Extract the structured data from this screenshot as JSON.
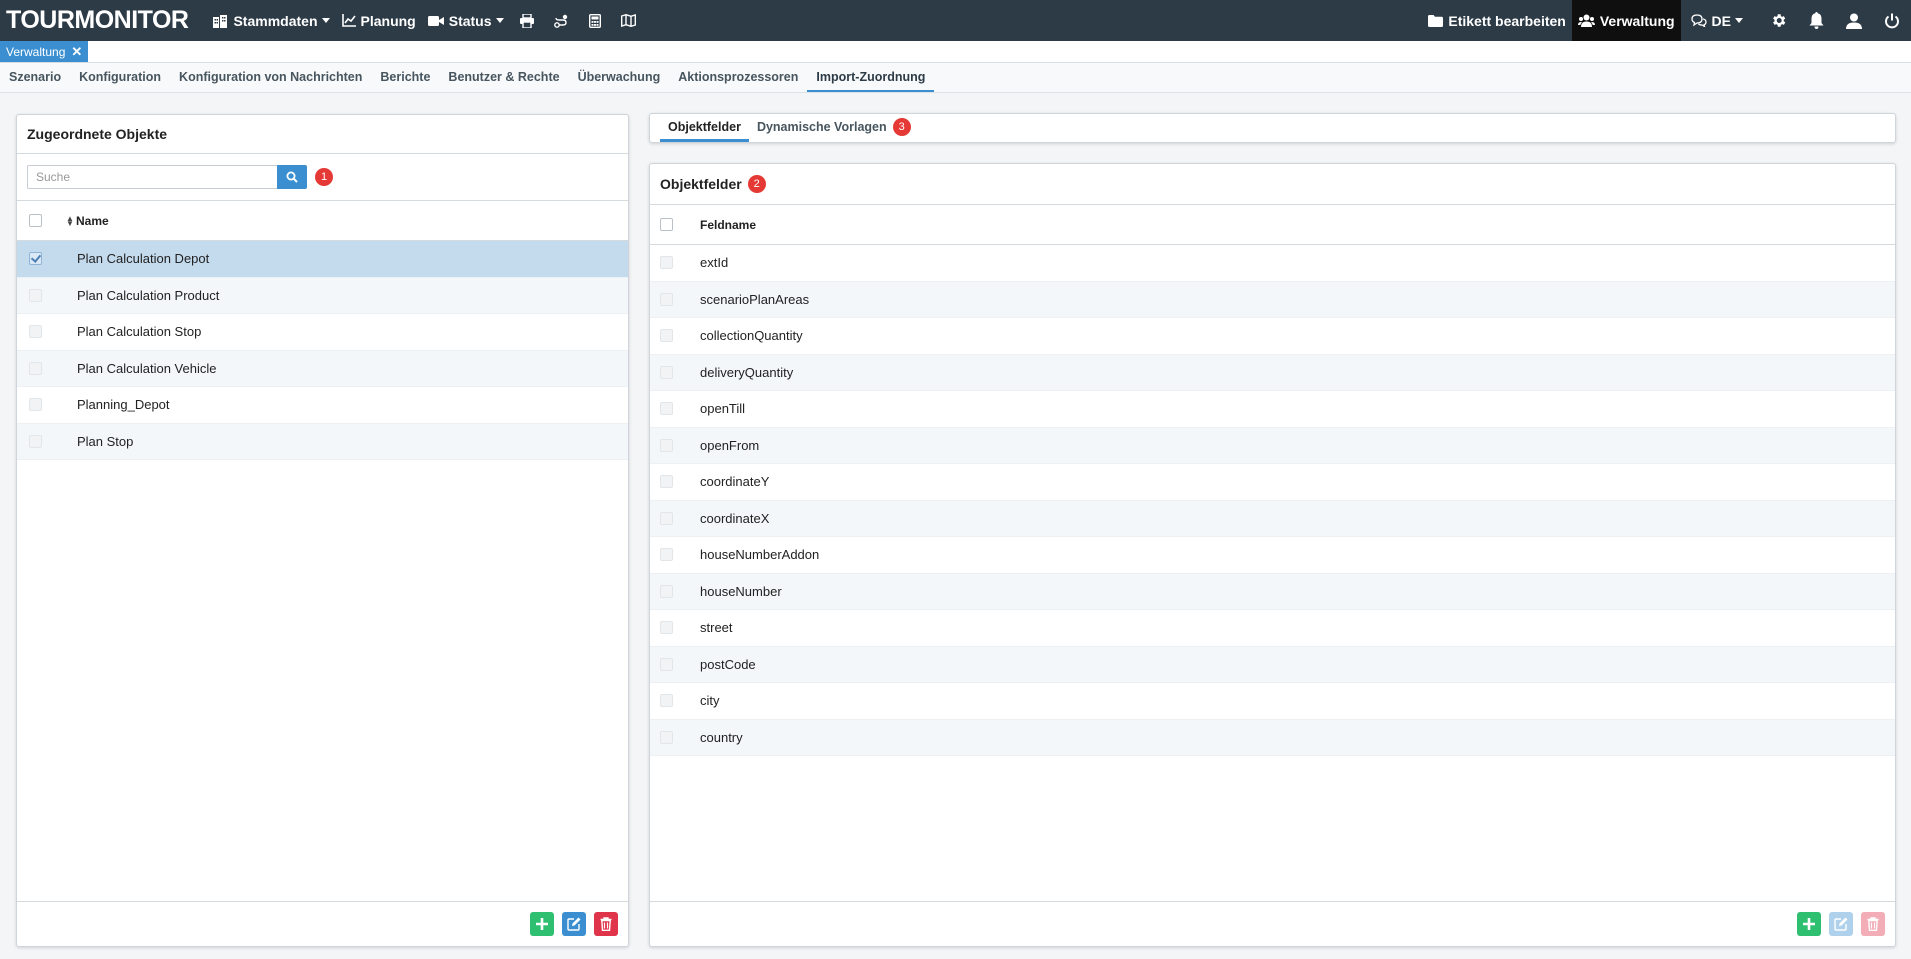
{
  "topbar": {
    "logo": "TOURMONITOR",
    "menu": [
      {
        "label": "Stammdaten",
        "icon": "building-icon",
        "dropdown": true
      },
      {
        "label": "Planung",
        "icon": "chart-icon",
        "dropdown": false
      },
      {
        "label": "Status",
        "icon": "video-icon",
        "dropdown": true
      }
    ],
    "tools": [
      "print-icon",
      "route-icon",
      "calculator-icon",
      "map-icon"
    ],
    "etikett_label": "Etikett bearbeiten",
    "verwaltung_label": "Verwaltung",
    "language": "DE"
  },
  "tabstrip": {
    "open_tab": "Verwaltung"
  },
  "subnav": {
    "items": [
      "Szenario",
      "Konfiguration",
      "Konfiguration von Nachrichten",
      "Berichte",
      "Benutzer & Rechte",
      "Überwachung",
      "Aktionsprozessoren",
      "Import-Zuordnung"
    ],
    "active": "Import-Zuordnung"
  },
  "left_panel": {
    "title": "Zugeordnete Objekte",
    "search_placeholder": "Suche",
    "search_badge": "1",
    "column_header": "Name",
    "rows": [
      "Plan Calculation Depot",
      "Plan Calculation Product",
      "Plan Calculation Stop",
      "Plan Calculation Vehicle",
      "Planning_Depot",
      "Plan Stop"
    ],
    "selected_row": "Plan Calculation Depot"
  },
  "right_tabs": {
    "tabs": [
      {
        "label": "Objektfelder",
        "active": true,
        "badge": ""
      },
      {
        "label": "Dynamische Vorlagen",
        "active": false,
        "badge": "3"
      }
    ]
  },
  "right_panel": {
    "title": "Objektfelder",
    "title_badge": "2",
    "column_header": "Feldname",
    "rows": [
      "extId",
      "scenarioPlanAreas",
      "collectionQuantity",
      "deliveryQuantity",
      "openTill",
      "openFrom",
      "coordinateY",
      "coordinateX",
      "houseNumberAddon",
      "houseNumber",
      "street",
      "postCode",
      "city",
      "country"
    ]
  },
  "colors": {
    "topbar": "#2d3b47",
    "accent": "#3b8fd1",
    "badge": "#e53935",
    "add": "#2fbf71",
    "delete": "#e0344a",
    "selected_row": "#c4daed"
  }
}
